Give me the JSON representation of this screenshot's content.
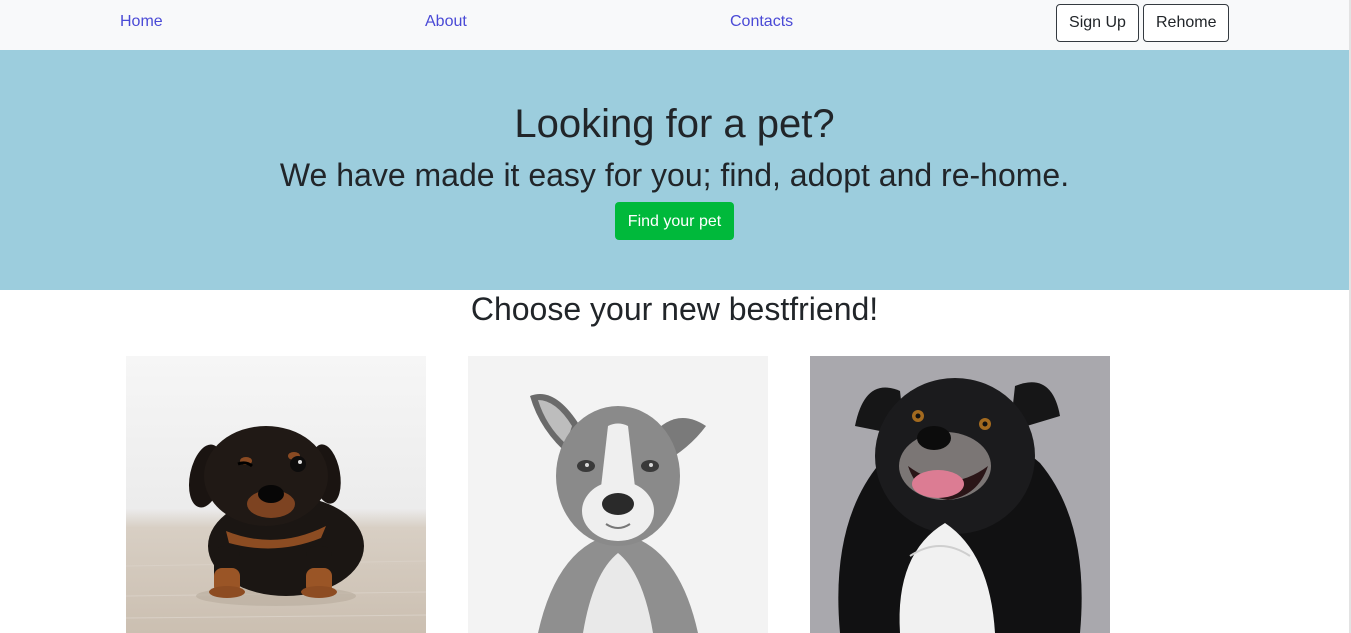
{
  "nav": {
    "links": [
      "Home",
      "About",
      "Contacts"
    ],
    "signup_label": "Sign Up",
    "rehome_label": "Rehome",
    "link_color": "#4a4ad6"
  },
  "hero": {
    "title": "Looking for a pet?",
    "subtitle": "We have made it easy for you; find, adopt and re-home.",
    "cta_label": "Find your pet",
    "background": "#9ccddd",
    "cta_color": "#00b93b"
  },
  "section": {
    "title": "Choose your new bestfriend!"
  },
  "pets": [
    {
      "image": "black-and-tan-puppy"
    },
    {
      "image": "grey-white-dog-portrait"
    },
    {
      "image": "black-white-fluffy-dog"
    }
  ]
}
